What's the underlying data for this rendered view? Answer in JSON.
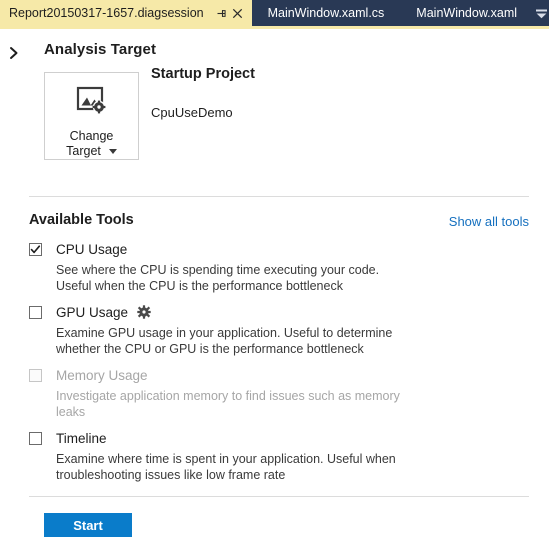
{
  "tabs": {
    "active": {
      "label": "Report20150317-1657.diagsession",
      "pin_icon": "pin-icon",
      "close_icon": "close-icon"
    },
    "inactive": [
      {
        "label": "MainWindow.xaml.cs"
      },
      {
        "label": "MainWindow.xaml"
      }
    ],
    "overflow_icon": "chevron-down-icon",
    "active_bg": "#f6e9a8",
    "bar_bg": "#293955"
  },
  "analysis": {
    "expander_icon": "chevron-right-icon",
    "title": "Analysis Target",
    "change_target": {
      "icon": "image-settings-icon",
      "line1": "Change",
      "line2": "Target",
      "caret_icon": "caret-down-icon"
    },
    "startup_project_label": "Startup Project",
    "startup_project_value": "CpuUseDemo"
  },
  "tools_section": {
    "title": "Available Tools",
    "show_all_link": "Show all tools",
    "link_color": "#1570bf",
    "items": [
      {
        "name": "CPU Usage",
        "checked": true,
        "enabled": true,
        "gear": false,
        "description": "See where the CPU is spending time executing your code. Useful when the CPU is the performance bottleneck"
      },
      {
        "name": "GPU Usage",
        "checked": false,
        "enabled": true,
        "gear": true,
        "gear_icon": "gear-icon",
        "description": "Examine GPU usage in your application. Useful to determine whether the CPU or GPU is the performance bottleneck"
      },
      {
        "name": "Memory Usage",
        "checked": false,
        "enabled": false,
        "gear": false,
        "description": "Investigate application memory to find issues such as memory leaks"
      },
      {
        "name": "Timeline",
        "checked": false,
        "enabled": true,
        "gear": false,
        "description": "Examine where time is spent in your application. Useful when troubleshooting issues like low frame rate"
      }
    ]
  },
  "footer": {
    "start_label": "Start",
    "start_color": "#0a7cca"
  }
}
